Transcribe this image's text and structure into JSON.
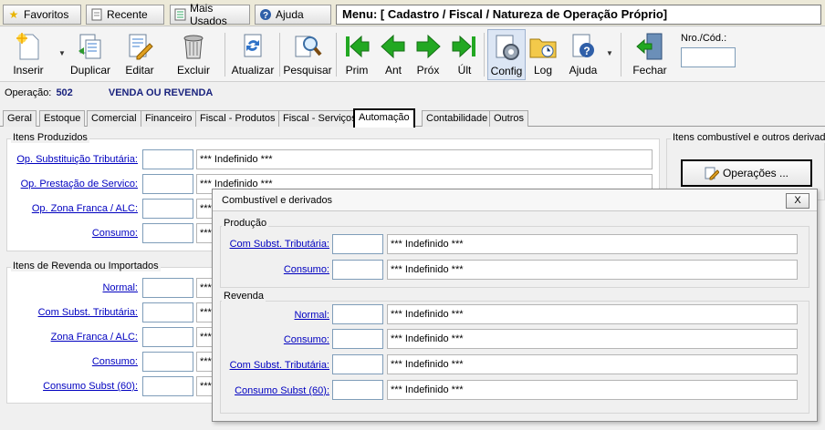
{
  "topbar": {
    "favoritos": "Favoritos",
    "recente": "Recente",
    "mais_usados": "Mais Usados",
    "ajuda": "Ajuda",
    "menu_title": "Menu: [ Cadastro / Fiscal / Natureza de Operação Próprio]"
  },
  "toolbar": {
    "inserir": "Inserir",
    "duplicar": "Duplicar",
    "editar": "Editar",
    "excluir": "Excluir",
    "atualizar": "Atualizar",
    "pesquisar": "Pesquisar",
    "prim": "Prim",
    "ant": "Ant",
    "prox": "Próx",
    "ult": "Últ",
    "config": "Config",
    "log": "Log",
    "ajuda": "Ajuda",
    "fechar": "Fechar",
    "nro_label": "Nro./Cód.:"
  },
  "operation": {
    "label": "Operação:",
    "number": "502",
    "name": "VENDA OU REVENDA"
  },
  "tabs": [
    "Geral",
    "Estoque",
    "Comercial",
    "Financeiro",
    "Fiscal - Produtos",
    "Fiscal - Serviços",
    "Automação",
    "Contabilidade",
    "Outros"
  ],
  "itens_produzidos": {
    "title": "Itens Produzidos",
    "rows": [
      {
        "label": "Op. Substituição Tributária:",
        "value": "*** Indefinido ***"
      },
      {
        "label": "Op. Prestação de Servico:",
        "value": "*** Indefinido ***"
      },
      {
        "label": "Op. Zona Franca / ALC:",
        "value": "***"
      },
      {
        "label": "Consumo:",
        "value": "***"
      }
    ]
  },
  "itens_revenda": {
    "title": "Itens de Revenda ou Importados",
    "rows": [
      {
        "label": "Normal:",
        "value": "***"
      },
      {
        "label": "Com Subst. Tributária:",
        "value": "***"
      },
      {
        "label": "Zona Franca / ALC:",
        "value": "***"
      },
      {
        "label": "Consumo:",
        "value": "***"
      },
      {
        "label": "Consumo Subst (60):",
        "value": "***"
      }
    ]
  },
  "combustivel": {
    "title": "Itens combustível e outros derivad",
    "button": "Operações ..."
  },
  "popup": {
    "title": "Combustível e derivados",
    "close": "X",
    "producao": {
      "title": "Produção",
      "rows": [
        {
          "label": "Com Subst. Tributária:",
          "value": "*** Indefinido ***"
        },
        {
          "label": "Consumo:",
          "value": "*** Indefinido ***"
        }
      ]
    },
    "revenda": {
      "title": "Revenda",
      "rows": [
        {
          "label": "Normal:",
          "value": "*** Indefinido ***"
        },
        {
          "label": "Consumo:",
          "value": "*** Indefinido ***"
        },
        {
          "label": "Com Subst. Tributária:",
          "value": "*** Indefinido ***"
        },
        {
          "label": "Consumo Subst (60):",
          "value": "*** Indefinido ***"
        }
      ]
    }
  },
  "colors": {
    "link": "#0000c0",
    "op_text": "#1a237e",
    "green_arrow": "#22a822"
  }
}
